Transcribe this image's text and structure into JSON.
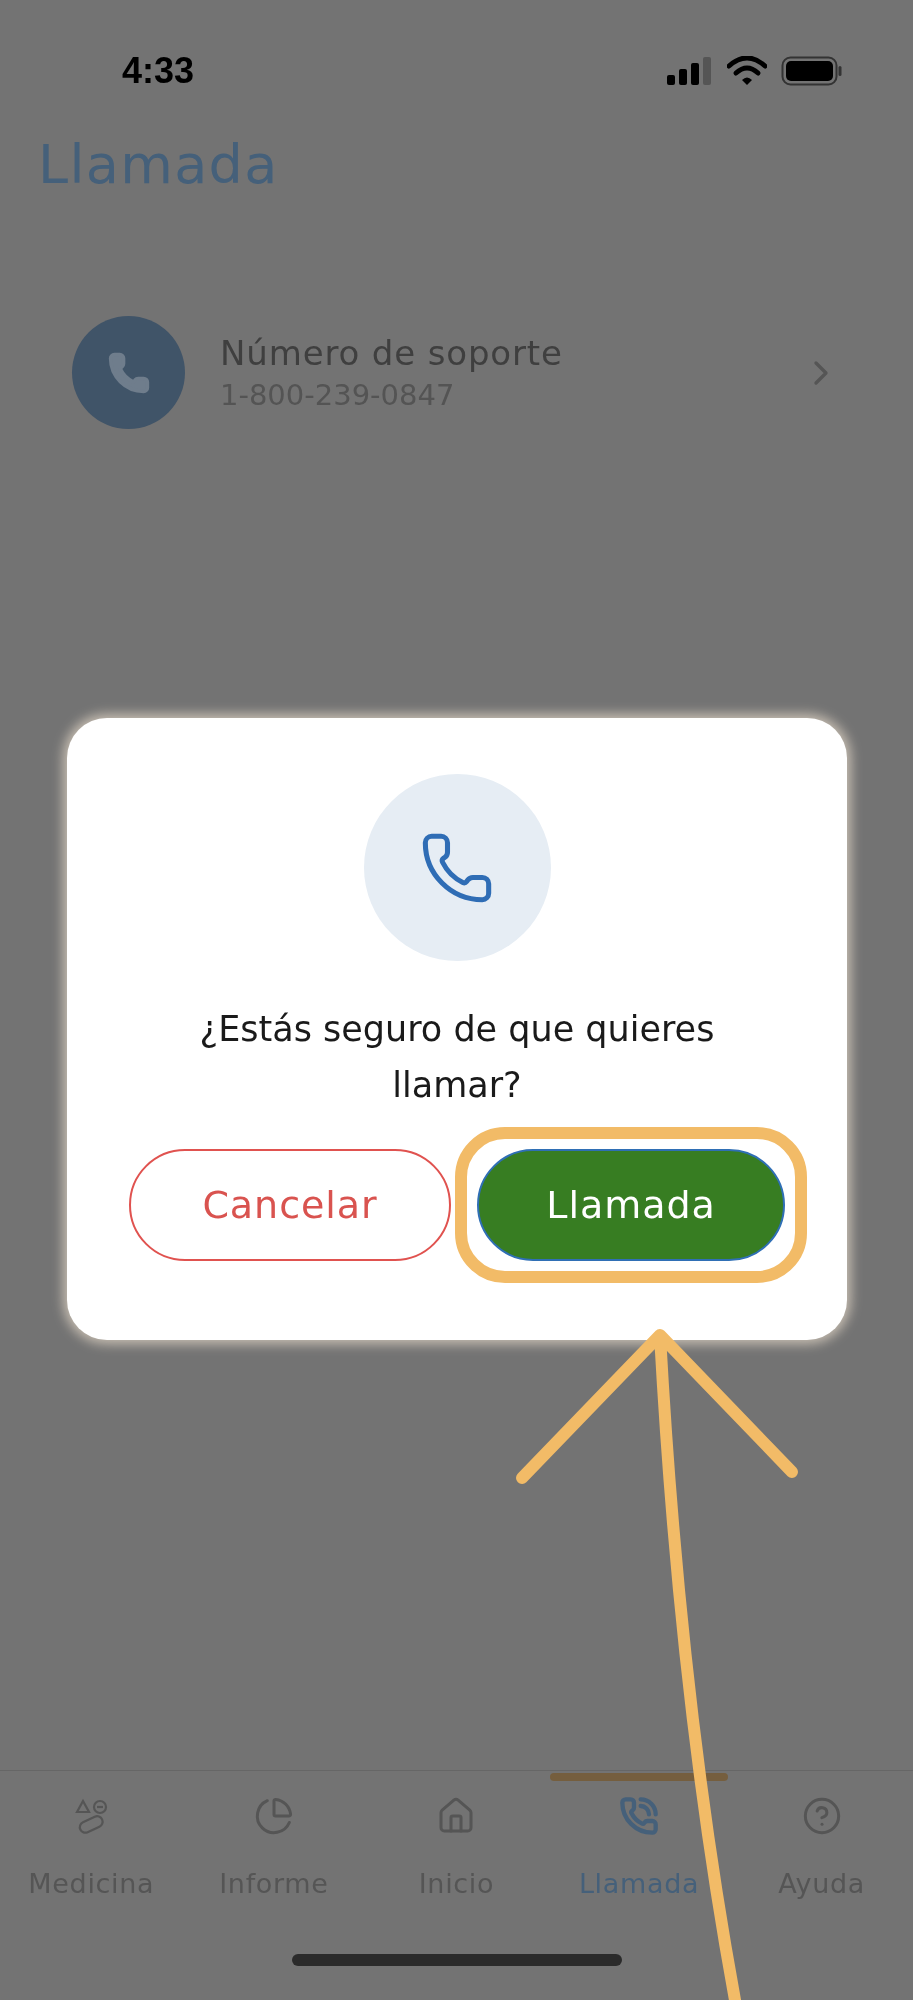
{
  "status_bar": {
    "time": "4:33"
  },
  "header": {
    "title": "Llamada"
  },
  "contacts": [
    {
      "title": "Número de soporte",
      "subtitle": "1-800-239-0847"
    }
  ],
  "dialog": {
    "message": "¿Estás seguro de que quieres llamar?",
    "buttons": [
      {
        "label": "Cancelar",
        "kind": "cancel",
        "highlighted": false
      },
      {
        "label": "Llamada",
        "kind": "confirm",
        "highlighted": true
      }
    ]
  },
  "tabs": [
    {
      "label": "Medicina",
      "kind": "medicine",
      "selected": false
    },
    {
      "label": "Informe",
      "kind": "report",
      "selected": false
    },
    {
      "label": "Inicio",
      "kind": "home",
      "selected": false
    },
    {
      "label": "Llamada",
      "kind": "call",
      "selected": true
    },
    {
      "label": "Ayuda",
      "kind": "help",
      "selected": false
    }
  ]
}
